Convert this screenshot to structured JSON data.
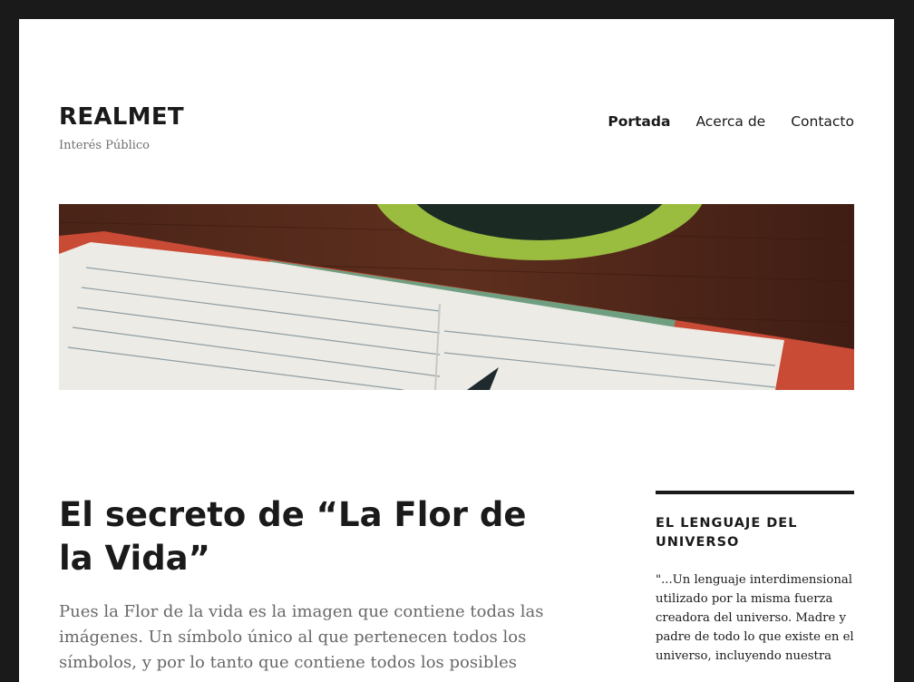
{
  "site": {
    "title": "REALMET",
    "description": "Interés Público"
  },
  "nav": {
    "items": [
      {
        "label": "Portada"
      },
      {
        "label": "Acerca de"
      },
      {
        "label": "Contacto"
      }
    ]
  },
  "post": {
    "title": "El secreto de “La Flor de la Vida”",
    "summary": "Pues la Flor de la vida es la imagen que contiene todas las imágenes. Un símbolo único al que pertenecen todos los símbolos, y por lo tanto que contiene todos los posibles"
  },
  "sidebar": {
    "widget_title": "EL LENGUAJE DEL UNIVERSO",
    "widget_text": "\"...Un lenguaje interdimensional utilizado por la misma fuerza creadora del universo. Madre y padre de todo lo que existe en el universo, incluyendo nuestra"
  },
  "colors": {
    "frame": "#1a1a1a",
    "text": "#1a1a1a",
    "muted": "#707070"
  }
}
